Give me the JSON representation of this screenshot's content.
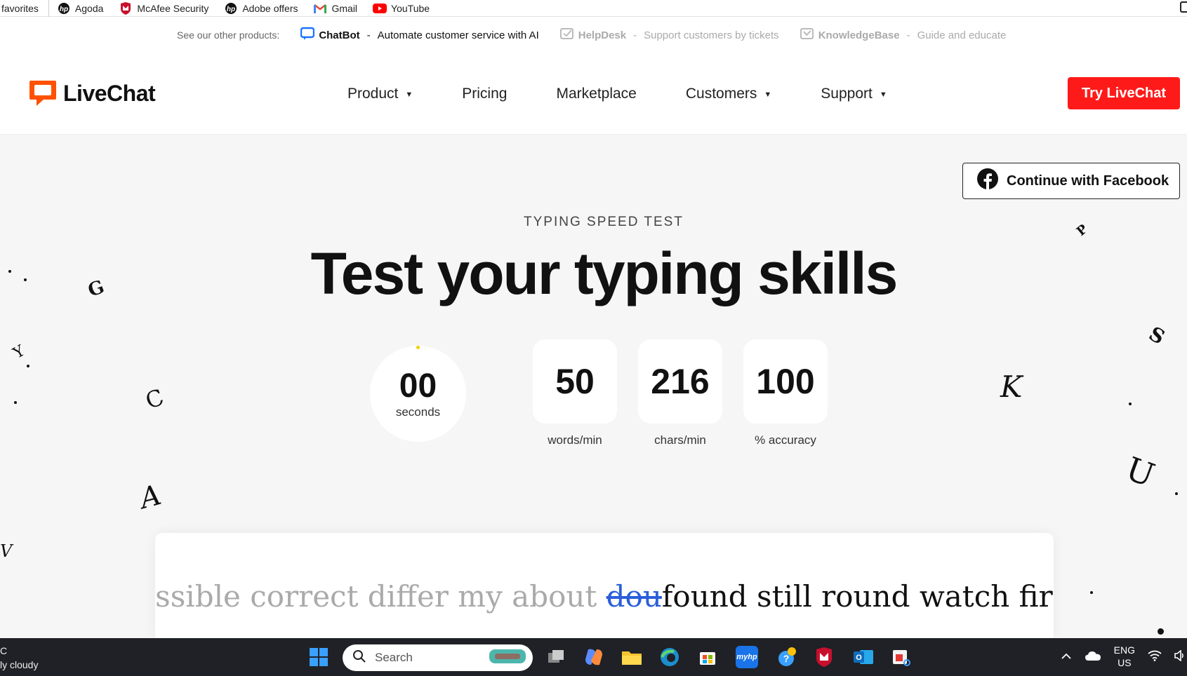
{
  "favorites_bar": {
    "items": [
      {
        "label": "favorites",
        "icon": ""
      },
      {
        "label": "Agoda",
        "icon": "hp-icon"
      },
      {
        "label": "McAfee Security",
        "icon": "mcafee-icon"
      },
      {
        "label": "Adobe offers",
        "icon": "hp-icon"
      },
      {
        "label": "Gmail",
        "icon": "gmail-icon"
      },
      {
        "label": "YouTube",
        "icon": "youtube-icon"
      }
    ]
  },
  "products_strip": {
    "lead": "See our other products:",
    "items": [
      {
        "name": "ChatBot",
        "tagline": "Automate customer service with AI"
      },
      {
        "name": "HelpDesk",
        "tagline": "Support customers by tickets"
      },
      {
        "name": "KnowledgeBase",
        "tagline": "Guide and educate"
      }
    ],
    "separator": "-"
  },
  "header": {
    "logo_text": "LiveChat",
    "nav": [
      {
        "label": "Product",
        "caret": "▼"
      },
      {
        "label": "Pricing",
        "caret": ""
      },
      {
        "label": "Marketplace",
        "caret": ""
      },
      {
        "label": "Customers",
        "caret": "▼"
      },
      {
        "label": "Support",
        "caret": "▼"
      }
    ],
    "cta": "Try LiveChat"
  },
  "main": {
    "facebook_button": "Continue with Facebook",
    "eyebrow": "TYPING SPEED TEST",
    "headline": "Test your typing skills",
    "timer": {
      "value": "00",
      "unit": "seconds"
    },
    "stats": [
      {
        "value": "50",
        "label": "words/min"
      },
      {
        "value": "216",
        "label": "chars/min"
      },
      {
        "value": "100",
        "label": "% accuracy"
      }
    ],
    "typing": {
      "typed": "possible correct differ my about ",
      "wrong": "dou",
      "upcoming": "found still round watch fire write r"
    },
    "floating_letters": [
      "G",
      "Y",
      "C",
      "A",
      "V",
      "P",
      "S",
      "K",
      "U"
    ]
  },
  "taskbar": {
    "weather_line1": "C",
    "weather_line2": "ly cloudy",
    "search_placeholder": "Search",
    "lang_line1": "ENG",
    "lang_line2": "US"
  },
  "colors": {
    "brand_orange": "#ff5100",
    "cta_red": "#ff1a1a",
    "wrong_word_blue": "#2b5fd9",
    "typed_gray": "#aaaaaa"
  }
}
